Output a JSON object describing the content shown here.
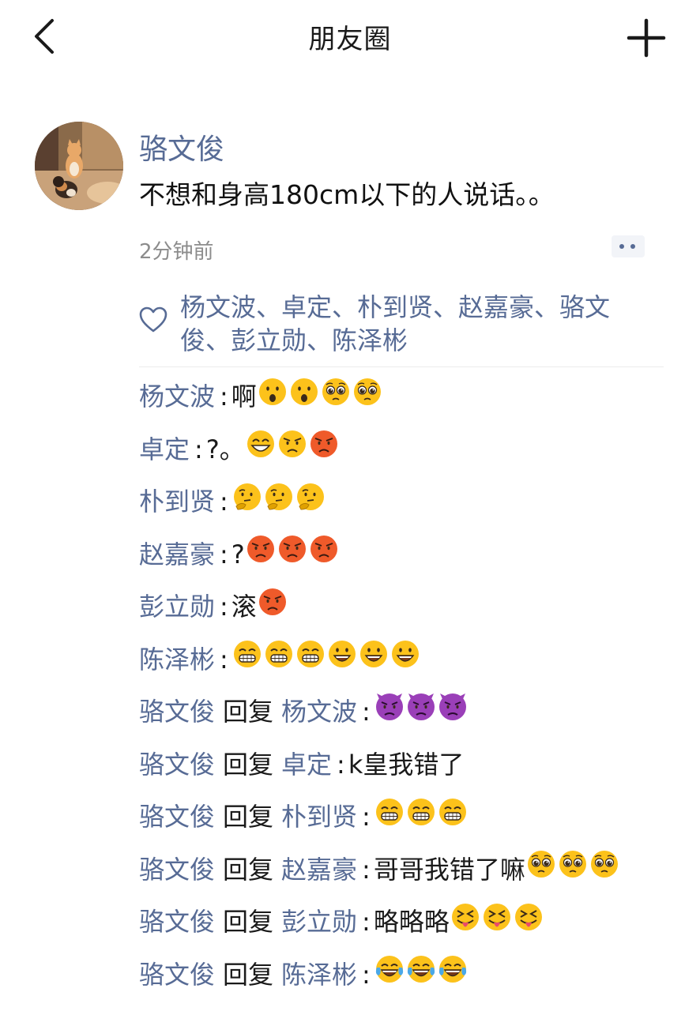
{
  "header": {
    "title": "朋友圈",
    "back_icon": "chevron-left-icon",
    "add_icon": "plus-icon"
  },
  "post": {
    "author": "骆文俊",
    "text": "不想和身高180cm以下的人说话。。",
    "time": "2分钟前",
    "avatar": "cat-photo-avatar",
    "more_icon": "more-dots-icon"
  },
  "likes": {
    "icon": "heart-outline-icon",
    "names": "杨文波、卓定、朴到贤、赵嘉豪、骆文俊、彭立勋、陈泽彬"
  },
  "comments": [
    {
      "user": "杨文波",
      "reply_to": "",
      "text": "啊",
      "emojis": [
        "surprised",
        "surprised",
        "pleading",
        "pleading"
      ]
    },
    {
      "user": "卓定",
      "reply_to": "",
      "text": "?。",
      "emojis": [
        "grin-smile",
        "angry",
        "angry-red"
      ]
    },
    {
      "user": "朴到贤",
      "reply_to": "",
      "text": "",
      "emojis": [
        "thinking",
        "thinking",
        "thinking"
      ]
    },
    {
      "user": "赵嘉豪",
      "reply_to": "",
      "text": "?",
      "emojis": [
        "angry-red",
        "angry-red",
        "angry-red"
      ]
    },
    {
      "user": "彭立勋",
      "reply_to": "",
      "text": "滚",
      "emojis": [
        "angry-red"
      ]
    },
    {
      "user": "陈泽彬",
      "reply_to": "",
      "text": "",
      "emojis": [
        "grin-teeth",
        "grin-teeth",
        "grin-teeth",
        "smiley",
        "smiley",
        "smiley"
      ]
    },
    {
      "user": "骆文俊",
      "reply_to": "杨文波",
      "text": "",
      "emojis": [
        "imp",
        "imp",
        "imp"
      ]
    },
    {
      "user": "骆文俊",
      "reply_to": "卓定",
      "text": "k皇我错了",
      "emojis": []
    },
    {
      "user": "骆文俊",
      "reply_to": "朴到贤",
      "text": "",
      "emojis": [
        "grin-teeth",
        "grin-teeth",
        "grin-teeth"
      ]
    },
    {
      "user": "骆文俊",
      "reply_to": "赵嘉豪",
      "text": "哥哥我错了嘛",
      "emojis": [
        "pleading",
        "pleading",
        "pleading"
      ]
    },
    {
      "user": "骆文俊",
      "reply_to": "彭立勋",
      "text": "略略略",
      "emojis": [
        "tongue-squint",
        "tongue-squint",
        "tongue-squint"
      ]
    },
    {
      "user": "骆文俊",
      "reply_to": "陈泽彬",
      "text": "",
      "emojis": [
        "tears-of-joy",
        "tears-of-joy",
        "tears-of-joy"
      ]
    }
  ],
  "reply_word": "回复",
  "colon": ":",
  "colors": {
    "link": "#576b95",
    "text": "#1a1a1a",
    "meta": "#8c8c8c"
  }
}
